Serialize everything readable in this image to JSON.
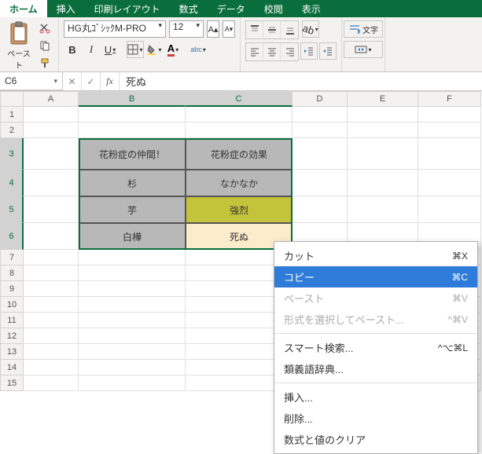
{
  "tabs": {
    "home": "ホーム",
    "insert": "挿入",
    "layout": "印刷レイアウト",
    "formulas": "数式",
    "data": "データ",
    "review": "校閲",
    "view": "表示"
  },
  "ribbon": {
    "paste_label": "ペースト",
    "font_name": "HG丸ｺﾞｼｯｸM-PRO",
    "font_size": "12",
    "bold": "B",
    "italic": "I",
    "underline": "U",
    "ruby": "abc",
    "wrap_label": "文字"
  },
  "namebox": "C6",
  "formula": "死ぬ",
  "cols": [
    "A",
    "B",
    "C",
    "D",
    "E",
    "F"
  ],
  "table": {
    "r3": {
      "b": "花粉症の仲間！",
      "c": "花粉症の効果"
    },
    "r4": {
      "b": "杉",
      "c": "なかなか"
    },
    "r5": {
      "b": "芋",
      "c": "強烈"
    },
    "r6": {
      "b": "白樺",
      "c": "死ぬ"
    }
  },
  "rows_small": [
    "7",
    "8",
    "9",
    "10",
    "11",
    "12",
    "13",
    "14",
    "15"
  ],
  "ctx": {
    "cut": "カット",
    "cut_k": "⌘X",
    "copy": "コピー",
    "copy_k": "⌘C",
    "paste": "ペースト",
    "paste_k": "⌘V",
    "paste_special": "形式を選択してペースト...",
    "paste_special_k": "^⌘V",
    "smart": "スマート検索...",
    "smart_k": "^⌥⌘L",
    "thesaurus": "類義語辞典...",
    "insert": "挿入...",
    "delete": "削除...",
    "clear": "数式と値のクリア"
  }
}
